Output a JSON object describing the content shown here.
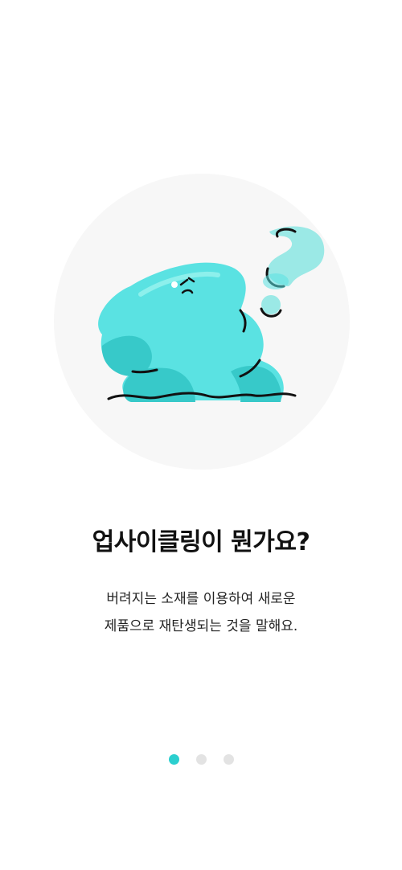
{
  "onboarding": {
    "illustration": "confused-blob-with-question-mark",
    "title": "업사이클링이 뭔가요?",
    "description_lines": [
      "버려지는 소재를 이용하여 새로운",
      "제품으로 재탄생되는 것을 말해요."
    ],
    "pager": {
      "total_pages": 3,
      "current_page": 1
    }
  },
  "colors": {
    "accent": "#2bcfcf",
    "blob_main": "#5ae2e2",
    "blob_shadow": "#37c9c9",
    "question_mark": "#9be9e6",
    "circle_bg": "#f7f7f7",
    "dot_inactive": "#e3e3e3"
  }
}
